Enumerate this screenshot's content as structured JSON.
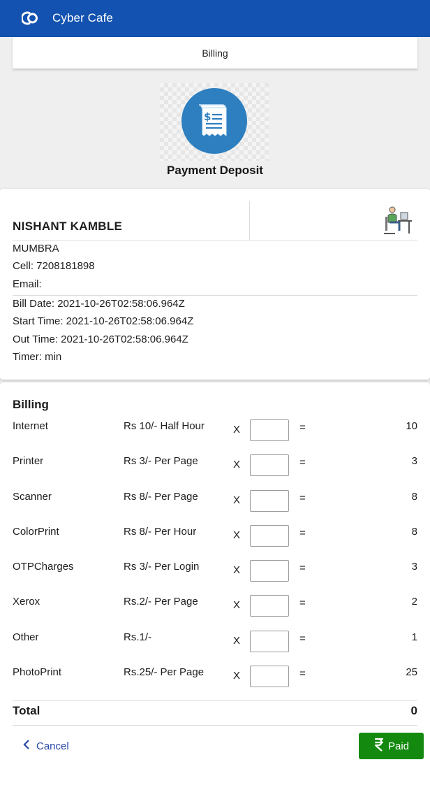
{
  "app": {
    "title": "Cyber Cafe"
  },
  "tab": {
    "label": "Billing"
  },
  "hero": {
    "title": "Payment Deposit"
  },
  "customer": {
    "name": "NISHANT KAMBLE",
    "address": "MUMBRA",
    "cell": "Cell: 7208181898",
    "email": "Email:",
    "bill_date": "Bill Date: 2021-10-26T02:58:06.964Z",
    "start_time": "Start Time: 2021-10-26T02:58:06.964Z",
    "out_time": "Out Time: 2021-10-26T02:58:06.964Z",
    "timer": "Timer: min"
  },
  "billing": {
    "title": "Billing",
    "times_symbol": "X",
    "equals_symbol": "=",
    "items": [
      {
        "name": "Internet",
        "rate": "Rs 10/- Half Hour",
        "qty": "",
        "amount": "10"
      },
      {
        "name": "Printer",
        "rate": "Rs 3/- Per Page",
        "qty": "",
        "amount": "3"
      },
      {
        "name": "Scanner",
        "rate": "Rs 8/- Per Page",
        "qty": "",
        "amount": "8"
      },
      {
        "name": "ColorPrint",
        "rate": "Rs 8/- Per Hour",
        "qty": "",
        "amount": "8"
      },
      {
        "name": "OTPCharges",
        "rate": "Rs 3/- Per Login",
        "qty": "",
        "amount": "3"
      },
      {
        "name": "Xerox",
        "rate": "Rs.2/- Per Page",
        "qty": "",
        "amount": "2"
      },
      {
        "name": "Other",
        "rate": "Rs.1/-",
        "qty": "",
        "amount": "1"
      },
      {
        "name": "PhotoPrint",
        "rate": "Rs.25/- Per Page",
        "qty": "",
        "amount": "25"
      }
    ],
    "total_label": "Total",
    "total_value": "0"
  },
  "actions": {
    "cancel_label": "Cancel",
    "paid_label": "Paid"
  },
  "icons": {
    "app_logo": "circle-logo-icon",
    "hero": "receipt-dollar-icon",
    "avatar": "person-at-desk-icon",
    "cancel": "chevron-left-icon",
    "paid": "rupee-icon"
  },
  "colors": {
    "appbar": "#1352b0",
    "hero_circle": "#2d7fc0",
    "paid_button": "#138a0f",
    "cancel_link": "#2a4aa8"
  }
}
